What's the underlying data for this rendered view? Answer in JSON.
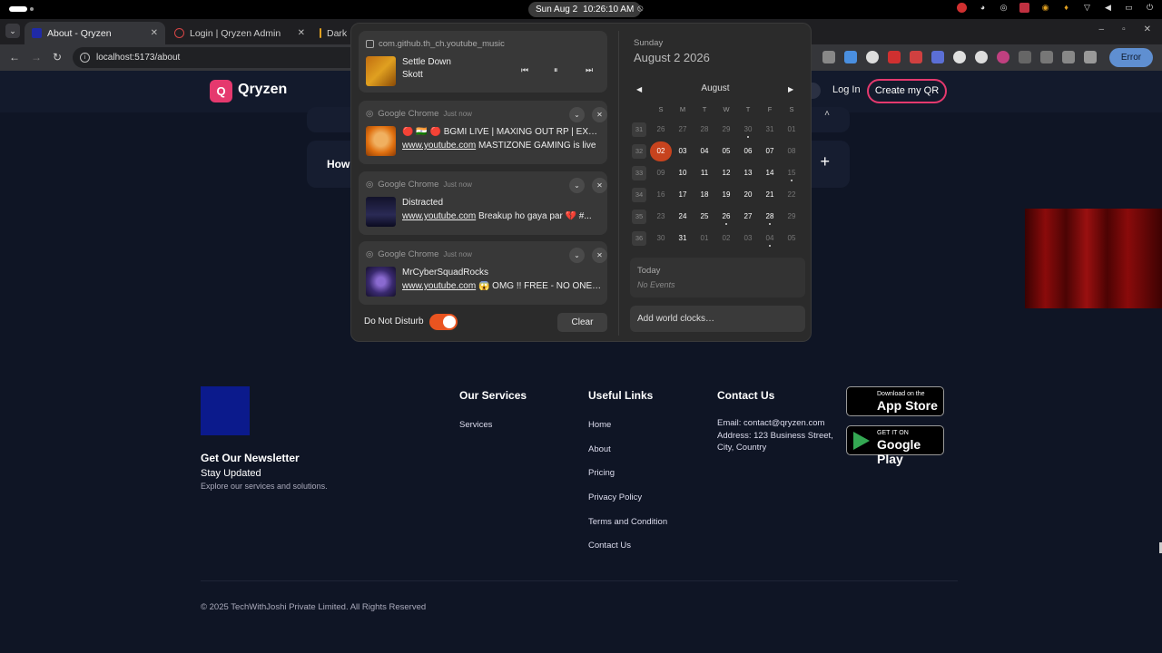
{
  "topbar": {
    "date": "Sun Aug 2",
    "time": "10:26:10 AM",
    "tray_icons": [
      "record-icon",
      "discord-icon",
      "steam-icon",
      "screen-record-icon",
      "location-icon",
      "microphone-icon",
      "wifi-icon",
      "volume-icon",
      "battery-icon",
      "power-icon"
    ]
  },
  "browser": {
    "tabs": [
      {
        "label": "About - Qryzen",
        "color": "#1f2aa6"
      },
      {
        "label": "Login | Qryzen Admin",
        "color": "#d64545"
      },
      {
        "label": "Dark",
        "color": "#e0a020"
      }
    ],
    "url": "localhost:5173/about",
    "error_label": "Error"
  },
  "site": {
    "brand_letter": "Q",
    "brand": "Qryzen",
    "login": "Log In",
    "create": "Create my QR",
    "faq_how": "How",
    "faq_plus": "+",
    "footer": {
      "newsletter_title": "Get Our Newsletter",
      "stay_updated": "Stay Updated",
      "explore": "Explore our services and solutions.",
      "services_title": "Our Services",
      "services_links": [
        "Services"
      ],
      "useful_title": "Useful Links",
      "useful_links": [
        "Home",
        "About",
        "Pricing",
        "Privacy Policy",
        "Terms and Condition",
        "Contact Us"
      ],
      "contact_title": "Contact Us",
      "contact_email": "Email: contact@qryzen.com",
      "contact_address": "Address: 123 Business Street, City, Country",
      "appstore_small": "Download on the",
      "appstore_big": "App Store",
      "play_small": "GET IT ON",
      "play_big": "Google Play",
      "copyright": "© 2025 TechWithJoshi Private Limited. All Rights Reserved"
    }
  },
  "notifications": {
    "media": {
      "app": "com.github.th_ch.youtube_music",
      "song": "Settle Down",
      "artist": "Skott"
    },
    "items": [
      {
        "app": "Google Chrome",
        "time": "Just now",
        "title": "🔴 🇮🇳 🔴 BGMI LIVE | MAXING OUT RP | EXPLORING",
        "link": "www.youtube.com",
        "body": "MASTIZONE GAMING is live"
      },
      {
        "app": "Google Chrome",
        "time": "Just now",
        "title": "Distracted",
        "link": "www.youtube.com",
        "body": "Breakup ho gaya par 💔 #..."
      },
      {
        "app": "Google Chrome",
        "time": "Just now",
        "title": "MrCyberSquadRocks",
        "link": "www.youtube.com",
        "body": "😱 OMG !! FREE - NO ONE ..."
      }
    ],
    "dnd_label": "Do Not Disturb",
    "dnd_on": true,
    "clear": "Clear"
  },
  "calendar": {
    "weekday": "Sunday",
    "date": "August 2 2026",
    "month": "August",
    "headers": [
      "S",
      "M",
      "T",
      "W",
      "T",
      "F",
      "S"
    ],
    "weeks": [
      {
        "num": "31",
        "days": [
          [
            "26",
            0,
            0
          ],
          [
            "27",
            0,
            0
          ],
          [
            "28",
            0,
            0
          ],
          [
            "29",
            0,
            0
          ],
          [
            "30",
            0,
            1
          ],
          [
            "31",
            0,
            0
          ],
          [
            "01",
            0,
            0
          ]
        ]
      },
      {
        "num": "32",
        "days": [
          [
            "02",
            1,
            0
          ],
          [
            "03",
            1,
            0
          ],
          [
            "04",
            1,
            0
          ],
          [
            "05",
            1,
            0
          ],
          [
            "06",
            1,
            0
          ],
          [
            "07",
            1,
            0
          ],
          [
            "08",
            0,
            0
          ]
        ]
      },
      {
        "num": "33",
        "days": [
          [
            "09",
            0,
            0
          ],
          [
            "10",
            1,
            0
          ],
          [
            "11",
            1,
            0
          ],
          [
            "12",
            1,
            0
          ],
          [
            "13",
            1,
            0
          ],
          [
            "14",
            1,
            0
          ],
          [
            "15",
            0,
            1
          ]
        ]
      },
      {
        "num": "34",
        "days": [
          [
            "16",
            0,
            0
          ],
          [
            "17",
            1,
            0
          ],
          [
            "18",
            1,
            0
          ],
          [
            "19",
            1,
            0
          ],
          [
            "20",
            1,
            0
          ],
          [
            "21",
            1,
            0
          ],
          [
            "22",
            0,
            0
          ]
        ]
      },
      {
        "num": "35",
        "days": [
          [
            "23",
            0,
            0
          ],
          [
            "24",
            1,
            0
          ],
          [
            "25",
            1,
            0
          ],
          [
            "26",
            1,
            1
          ],
          [
            "27",
            1,
            0
          ],
          [
            "28",
            1,
            1
          ],
          [
            "29",
            0,
            0
          ]
        ]
      },
      {
        "num": "36",
        "days": [
          [
            "30",
            0,
            0
          ],
          [
            "31",
            1,
            0
          ],
          [
            "01",
            0,
            0
          ],
          [
            "02",
            0,
            0
          ],
          [
            "03",
            0,
            0
          ],
          [
            "04",
            0,
            1
          ],
          [
            "05",
            0,
            0
          ]
        ]
      }
    ],
    "today_day": "02",
    "events_title": "Today",
    "events_empty": "No Events",
    "world_clocks": "Add world clocks…"
  }
}
